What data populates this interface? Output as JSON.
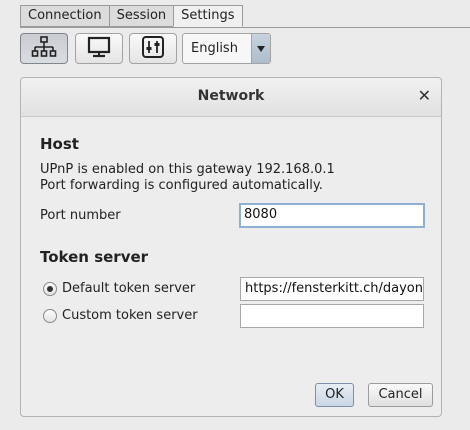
{
  "tabs": [
    {
      "label": "Connection"
    },
    {
      "label": "Session"
    },
    {
      "label": "Settings"
    }
  ],
  "toolbar": {
    "buttons": [
      {
        "icon": "network-icon",
        "pressed": true
      },
      {
        "icon": "monitor-icon",
        "pressed": false
      },
      {
        "icon": "sliders-icon",
        "pressed": false
      }
    ],
    "language": "English"
  },
  "dialog": {
    "title": "Network",
    "close_glyph": "✕",
    "host": {
      "heading": "Host",
      "upnp_line1": "UPnP is enabled on this gateway 192.168.0.1",
      "upnp_line2": "Port forwarding is configured automatically.",
      "port_label": "Port number",
      "port_value": "8080"
    },
    "token": {
      "heading": "Token server",
      "default_label": "Default token server",
      "default_value": "https://fensterkitt.ch/dayon/",
      "custom_label": "Custom token server",
      "custom_value": "",
      "selected": "default"
    },
    "ok_label": "OK",
    "cancel_label": "Cancel"
  }
}
